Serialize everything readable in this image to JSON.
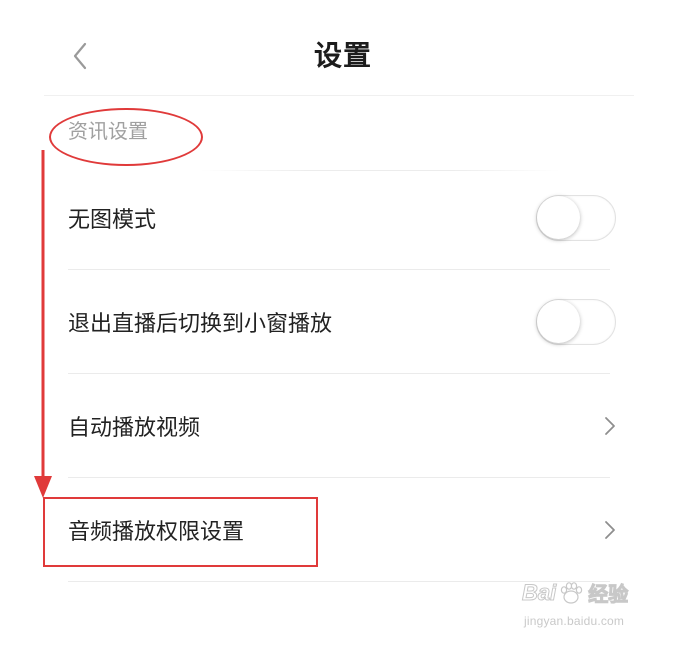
{
  "header": {
    "title": "设置",
    "back_icon": "chevron-left-icon"
  },
  "section": {
    "label": "资讯设置"
  },
  "rows": [
    {
      "label": "无图模式",
      "control": "toggle",
      "value": false
    },
    {
      "label": "退出直播后切换到小窗播放",
      "control": "toggle",
      "value": false
    },
    {
      "label": "自动播放视频",
      "control": "chevron",
      "icon": "chevron-right-icon"
    },
    {
      "label": "音频播放权限设置",
      "control": "chevron",
      "icon": "chevron-right-icon"
    }
  ],
  "annotations": {
    "color": "#e03a3a"
  },
  "watermark": {
    "brand": "Bai",
    "brand_suffix": "经验",
    "url": "jingyan.baidu.com"
  }
}
